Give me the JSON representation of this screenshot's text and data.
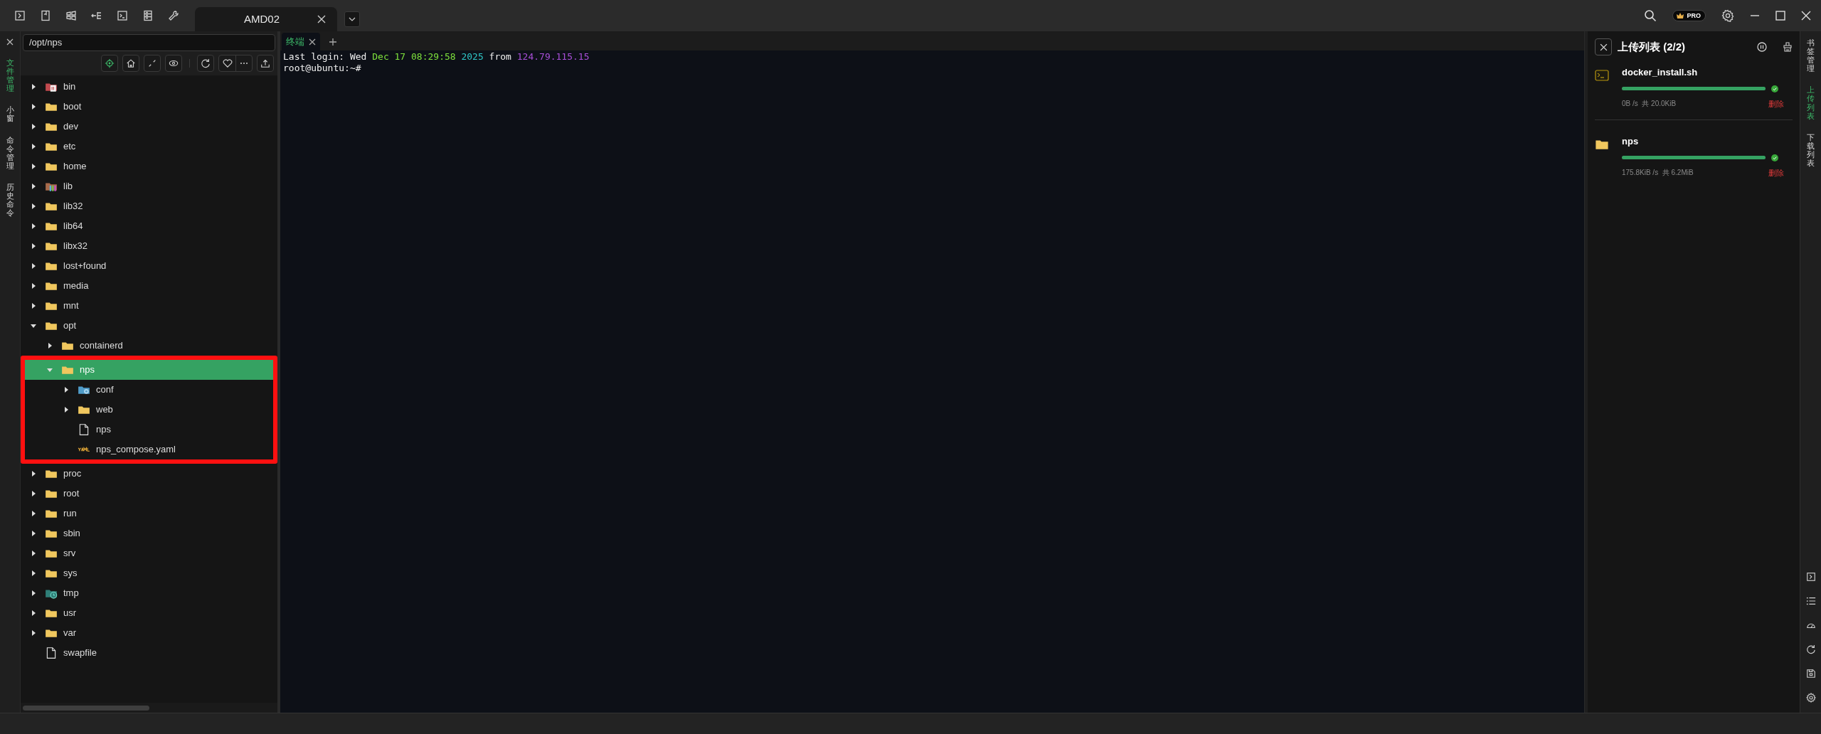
{
  "toolbar": {
    "tab": {
      "label": "AMD02",
      "selected": true
    }
  },
  "left_rail": [
    {
      "label": "文件管理",
      "selected": true
    },
    {
      "label": "小窗",
      "selected": false
    },
    {
      "label": "命令管理",
      "selected": false
    },
    {
      "label": "历史命令",
      "selected": false
    }
  ],
  "file_panel": {
    "path": "/opt/nps",
    "tree": [
      {
        "name": "bin",
        "kind": "folder-bin",
        "expanded": false,
        "selected": false
      },
      {
        "name": "boot",
        "kind": "folder",
        "expanded": false,
        "selected": false
      },
      {
        "name": "dev",
        "kind": "folder",
        "expanded": false,
        "selected": false
      },
      {
        "name": "etc",
        "kind": "folder",
        "expanded": false,
        "selected": false
      },
      {
        "name": "home",
        "kind": "folder",
        "expanded": false,
        "selected": false
      },
      {
        "name": "lib",
        "kind": "folder-lib",
        "expanded": false,
        "selected": false
      },
      {
        "name": "lib32",
        "kind": "folder",
        "expanded": false,
        "selected": false
      },
      {
        "name": "lib64",
        "kind": "folder",
        "expanded": false,
        "selected": false
      },
      {
        "name": "libx32",
        "kind": "folder",
        "expanded": false,
        "selected": false
      },
      {
        "name": "lost+found",
        "kind": "folder",
        "expanded": false,
        "selected": false
      },
      {
        "name": "media",
        "kind": "folder",
        "expanded": false,
        "selected": false
      },
      {
        "name": "mnt",
        "kind": "folder",
        "expanded": false,
        "selected": false
      },
      {
        "name": "opt",
        "kind": "folder",
        "expanded": true,
        "selected": false,
        "children": [
          {
            "name": "containerd",
            "kind": "folder",
            "expanded": false,
            "selected": false
          },
          {
            "name": "nps",
            "kind": "folder",
            "expanded": true,
            "selected": true,
            "highlighted": true,
            "children": [
              {
                "name": "conf",
                "kind": "folder-conf",
                "expanded": false,
                "selected": false
              },
              {
                "name": "web",
                "kind": "folder",
                "expanded": false,
                "selected": false
              },
              {
                "name": "nps",
                "kind": "file",
                "selected": false
              },
              {
                "name": "nps_compose.yaml",
                "kind": "yaml",
                "selected": false
              }
            ]
          }
        ]
      },
      {
        "name": "proc",
        "kind": "folder",
        "expanded": false,
        "selected": false
      },
      {
        "name": "root",
        "kind": "folder",
        "expanded": false,
        "selected": false
      },
      {
        "name": "run",
        "kind": "folder",
        "expanded": false,
        "selected": false
      },
      {
        "name": "sbin",
        "kind": "folder",
        "expanded": false,
        "selected": false
      },
      {
        "name": "srv",
        "kind": "folder",
        "expanded": false,
        "selected": false
      },
      {
        "name": "sys",
        "kind": "folder",
        "expanded": false,
        "selected": false
      },
      {
        "name": "tmp",
        "kind": "folder-tmp",
        "expanded": false,
        "selected": false
      },
      {
        "name": "usr",
        "kind": "folder",
        "expanded": false,
        "selected": false
      },
      {
        "name": "var",
        "kind": "folder",
        "expanded": false,
        "selected": false
      },
      {
        "name": "swapfile",
        "kind": "file",
        "selected": false
      }
    ]
  },
  "terminal": {
    "tab": {
      "label": "终端",
      "selected": true
    },
    "lines": [
      [
        {
          "text": "Last login: Wed ",
          "color": "#f0f0f0"
        },
        {
          "text": "Dec 17 08:29:58 ",
          "color": "#7ee03c"
        },
        {
          "text": "2025 ",
          "color": "#2fc6c6"
        },
        {
          "text": "from ",
          "color": "#f0f0f0"
        },
        {
          "text": "124.79.115.15",
          "color": "#a94fd8"
        }
      ],
      [
        {
          "text": "root@ubuntu:~#",
          "color": "#f0f0f0"
        }
      ]
    ]
  },
  "upload_panel": {
    "title": "上传列表 (2/2)",
    "items": [
      {
        "name": "docker_install.sh",
        "kind": "script",
        "level": 1,
        "done": true,
        "stats": "0B /s  共 20.0KiB",
        "action": "删除"
      },
      {
        "name": "nps",
        "kind": "folder",
        "level": 1,
        "done": true,
        "stats": "175.8KiB /s  共 6.2MiB",
        "action": "删除"
      }
    ]
  },
  "right_rail": [
    {
      "label": "书签管理",
      "selected": false
    },
    {
      "label": "上传列表",
      "selected": true
    },
    {
      "label": "下载列表",
      "selected": false
    }
  ],
  "badge": "PRO"
}
